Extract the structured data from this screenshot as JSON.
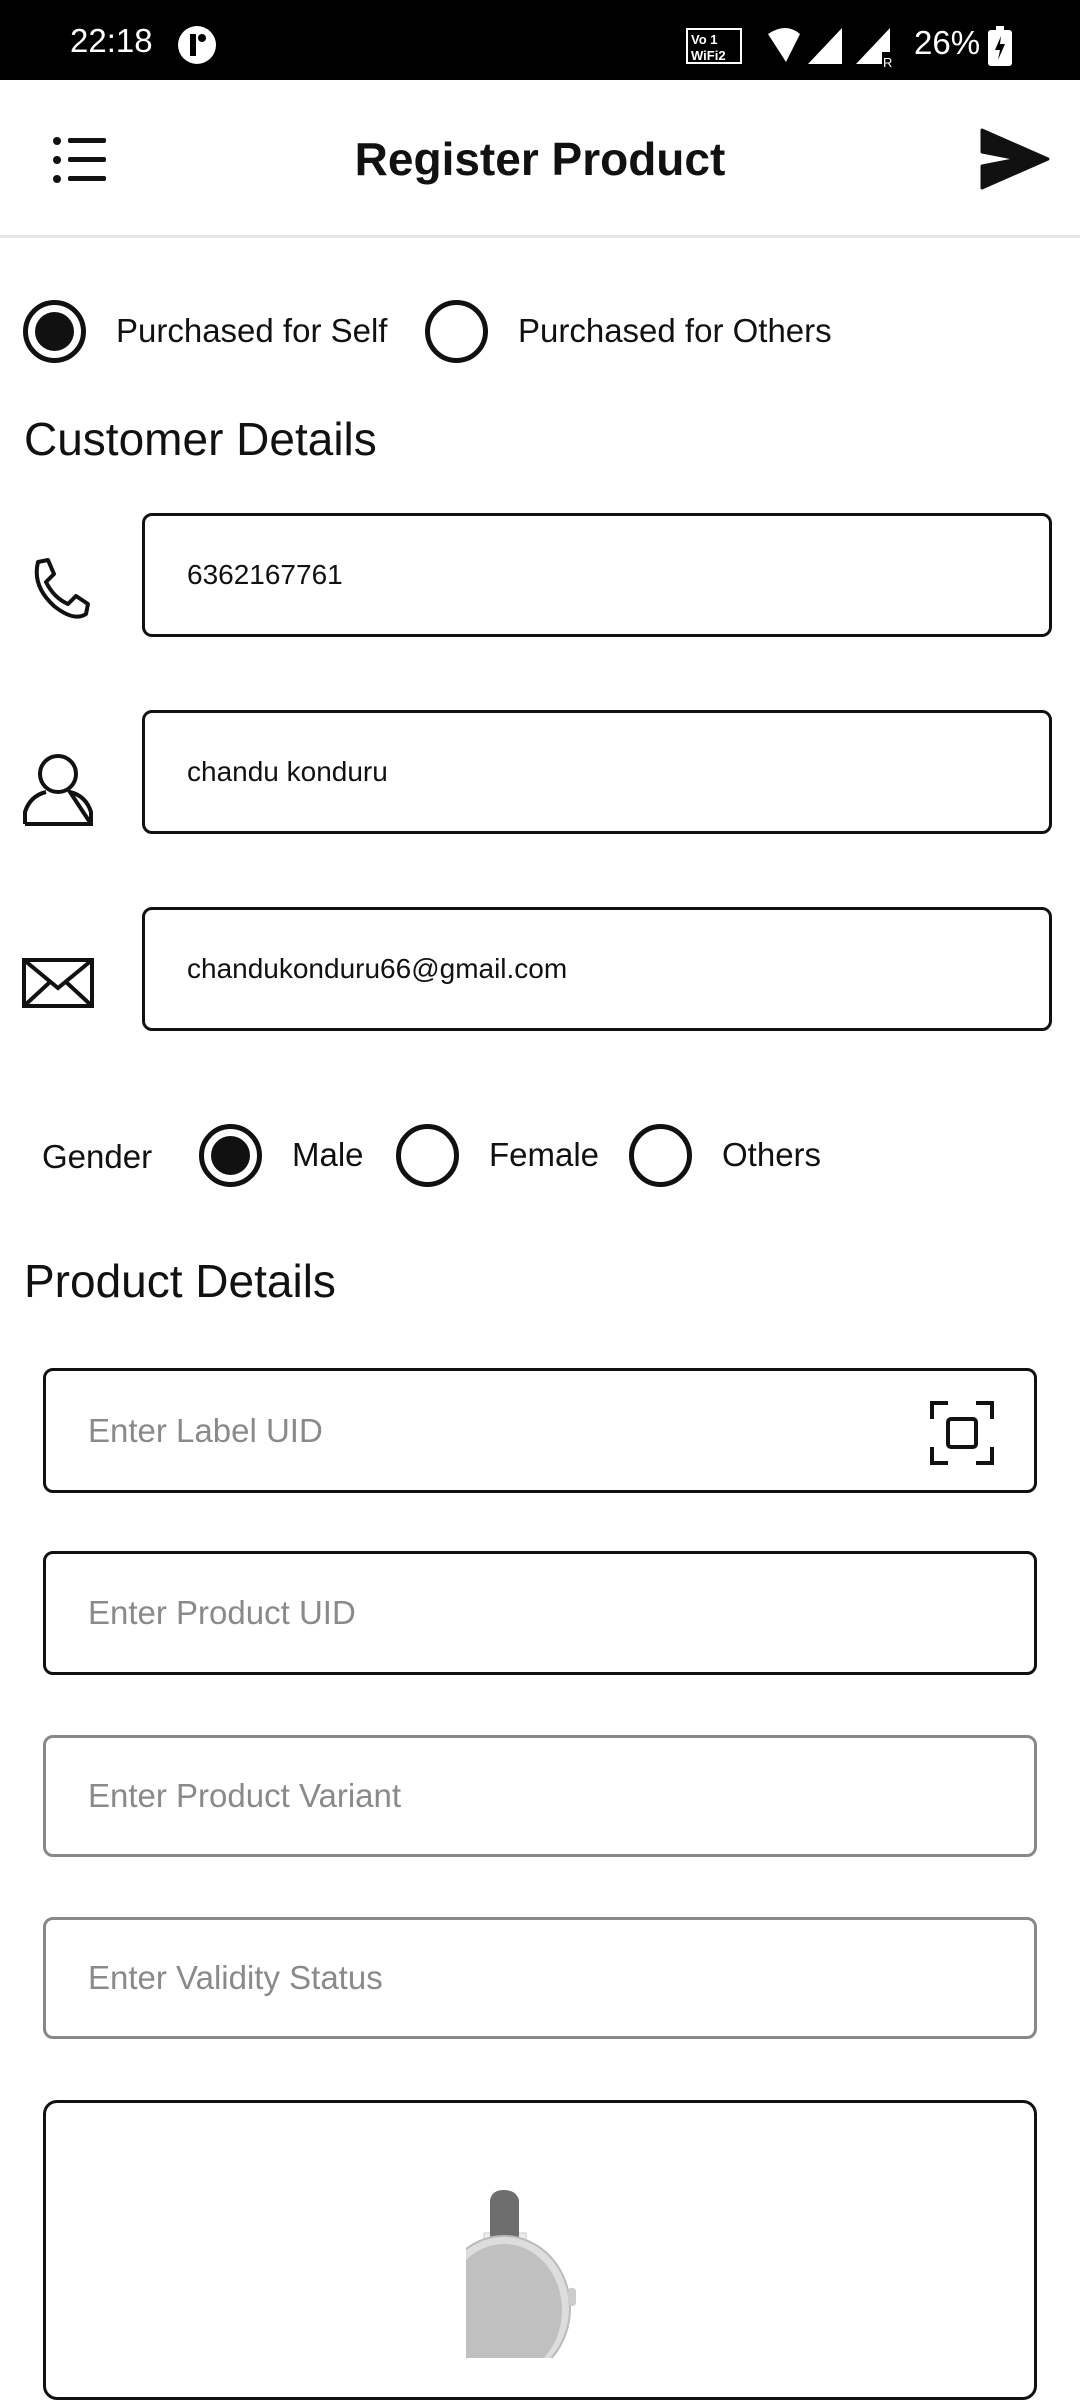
{
  "status_bar": {
    "time": "22:18",
    "battery": "26%",
    "icons": [
      "notification-icon",
      "vowifi-icon",
      "wifi-icon",
      "signal-icon",
      "signal-roaming-icon",
      "battery-charging-icon"
    ]
  },
  "app_bar": {
    "title": "Register Product",
    "menu_icon": "list-menu-icon",
    "send_icon": "send-icon"
  },
  "purchase_type": {
    "options": [
      "Purchased for Self",
      "Purchased for Others"
    ],
    "selected": "Purchased for Self"
  },
  "customer": {
    "heading": "Customer Details",
    "phone": "6362167761",
    "name": "chandu konduru",
    "email": "chandukonduru66@gmail.com",
    "gender_label": "Gender",
    "gender_options": [
      "Male",
      "Female",
      "Others"
    ],
    "gender_selected": "Male"
  },
  "product": {
    "heading": "Product Details",
    "label_uid_placeholder": "Enter Label UID",
    "product_uid_placeholder": "Enter Product UID",
    "variant_placeholder": "Enter Product Variant",
    "validity_placeholder": "Enter Validity Status"
  }
}
